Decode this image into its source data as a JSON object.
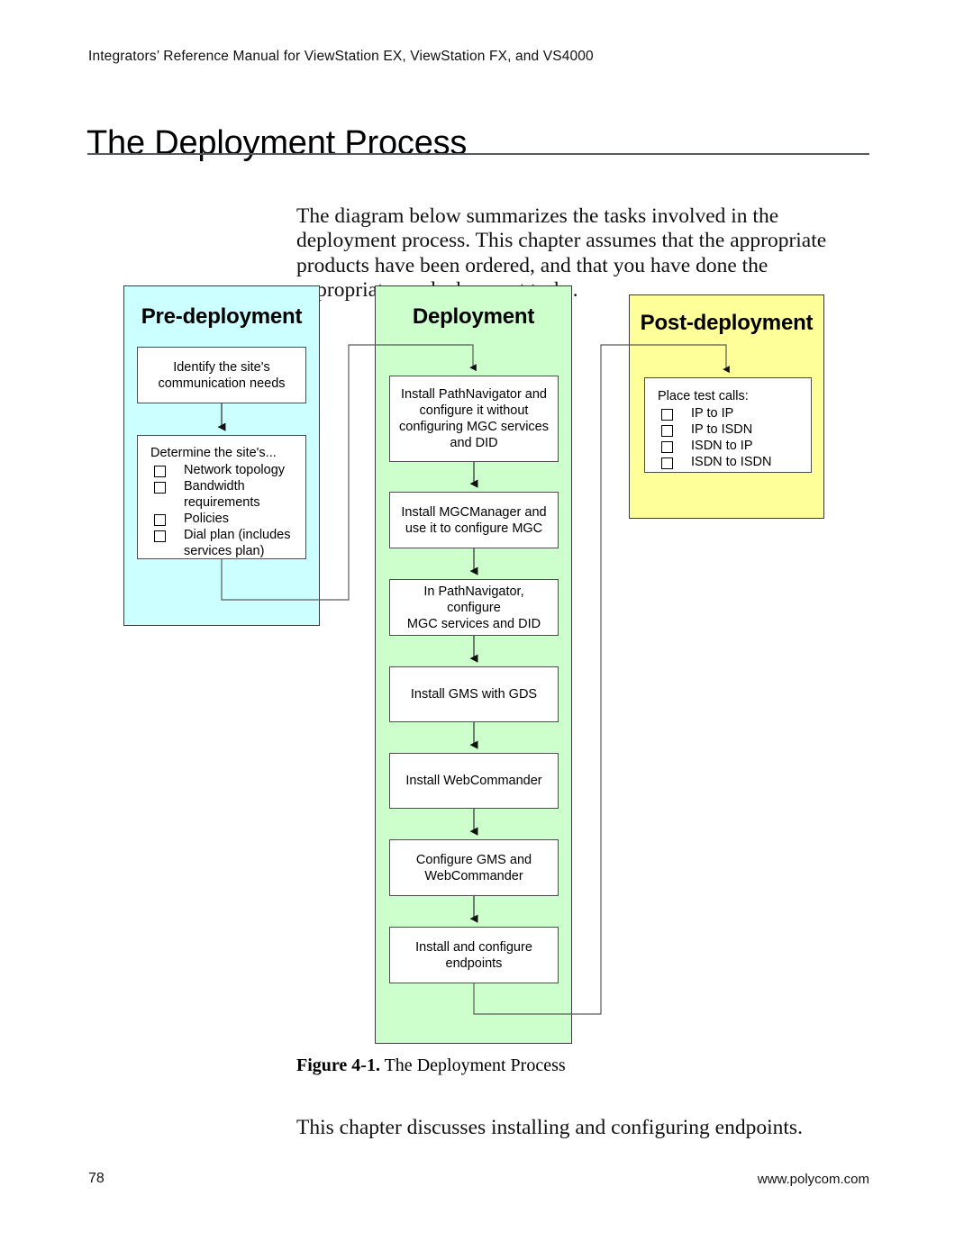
{
  "header": {
    "running_head": "Integrators’ Reference Manual for ViewStation EX, ViewStation FX, and VS4000",
    "title": "The Deployment Process"
  },
  "intro_paragraph": "The diagram below summarizes the tasks involved in the deployment process. This chapter assumes that the appropriate products have been ordered, and that you have done the appropriate predeployment tasks.",
  "figure": {
    "caption_number": "Figure 4-1.",
    "caption_text": "The Deployment Process",
    "colors": {
      "pre_deployment_fill": "#CCFFFF",
      "deployment_fill": "#CCFFCC",
      "post_deployment_fill": "#FFFF99",
      "box_fill": "#FFFFFF",
      "box_border": "#4C4C4C",
      "panel_border": "#3A3A3A",
      "connector": "#5A5A5A"
    },
    "panels": [
      {
        "id": "pre-deployment",
        "title": "Pre-deployment",
        "boxes": [
          {
            "id": "identify-needs",
            "type": "text",
            "text": "Identify the site's\ncommunication needs"
          },
          {
            "id": "determine-site",
            "type": "checklist",
            "heading": "Determine the site's...",
            "items": [
              "Network topology",
              "Bandwidth requirements",
              "Policies",
              "Dial plan (includes services plan)"
            ]
          }
        ]
      },
      {
        "id": "deployment",
        "title": "Deployment",
        "boxes": [
          {
            "id": "install-pathnavigator",
            "type": "text",
            "text": "Install PathNavigator and configure it without configuring MGC services and DID"
          },
          {
            "id": "install-mgcmanager",
            "type": "text",
            "text": "Install MGCManager and use it to configure MGC"
          },
          {
            "id": "configure-mgc-services",
            "type": "text",
            "text": "In PathNavigator, configure MGC services and DID"
          },
          {
            "id": "install-gms",
            "type": "text",
            "text": "Install GMS with GDS"
          },
          {
            "id": "install-webcommander",
            "type": "text",
            "text": "Install WebCommander"
          },
          {
            "id": "configure-gms-webcommander",
            "type": "text",
            "text": "Configure GMS and WebCommander"
          },
          {
            "id": "install-endpoints",
            "type": "text",
            "text": "Install and configure endpoints"
          }
        ]
      },
      {
        "id": "post-deployment",
        "title": "Post-deployment",
        "boxes": [
          {
            "id": "place-test-calls",
            "type": "checklist",
            "heading": "Place test calls:",
            "items": [
              "IP to IP",
              "IP to ISDN",
              "ISDN to IP",
              "ISDN to ISDN"
            ]
          }
        ]
      }
    ]
  },
  "closing_paragraph": "This chapter discusses installing and configuring endpoints.",
  "footer": {
    "page_number": "78",
    "website": "www.polycom.com"
  }
}
